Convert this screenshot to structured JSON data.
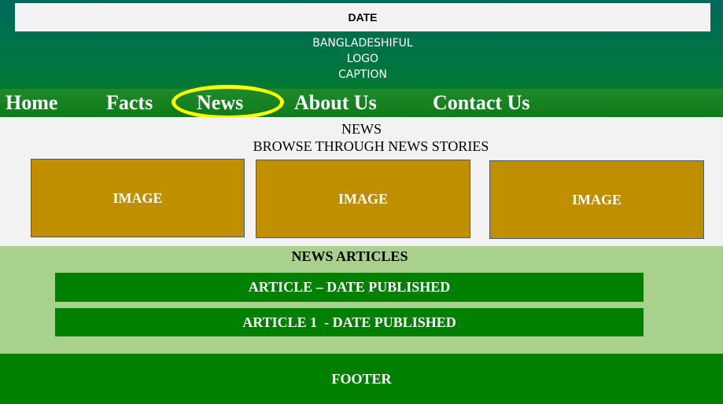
{
  "header": {
    "date": "DATE",
    "logo_lines": [
      "BANGLADESHIFUL",
      "LOGO",
      "CAPTION"
    ]
  },
  "nav": {
    "items": [
      "Home",
      "Facts",
      "News",
      "About Us",
      "Contact Us"
    ],
    "active": "News",
    "highlight_color": "#ffff00"
  },
  "news": {
    "title": "NEWS",
    "subtitle": "BROWSE THROUGH NEWS STORIES",
    "images": [
      "IMAGE",
      "IMAGE",
      "IMAGE"
    ]
  },
  "articles": {
    "title": "NEWS ARTICLES",
    "items": [
      "ARTICLE – DATE PUBLISHED",
      "ARTICLE 1  - DATE PUBLISHED"
    ]
  },
  "footer": {
    "label": "FOOTER"
  },
  "colors": {
    "header_green": "#007a33",
    "nav_green": "#0e7a18",
    "image_gold": "#bf8f00",
    "articles_bg": "#a9d18e",
    "bar_green": "#008000"
  }
}
